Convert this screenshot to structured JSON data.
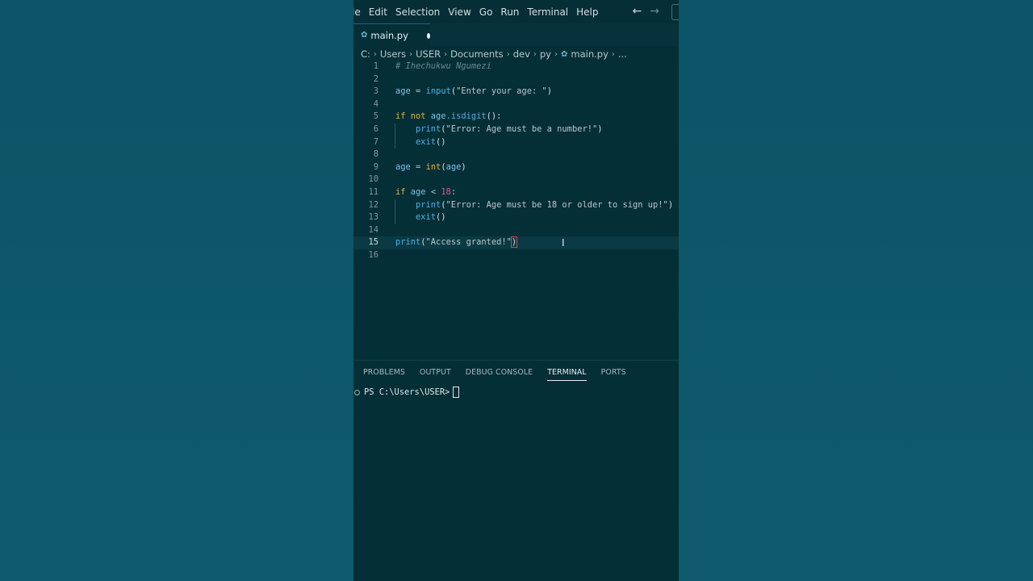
{
  "menu": [
    "le",
    "Edit",
    "Selection",
    "View",
    "Go",
    "Run",
    "Terminal",
    "Help"
  ],
  "nav": {
    "back": "←",
    "forward": "→"
  },
  "tab": {
    "label": "main.py",
    "icon": "python-icon"
  },
  "breadcrumb": [
    "C:",
    "Users",
    "USER",
    "Documents",
    "dev",
    "py",
    "main.py",
    "..."
  ],
  "code_lines": [
    {
      "n": "1"
    },
    {
      "n": "2"
    },
    {
      "n": "3"
    },
    {
      "n": "4"
    },
    {
      "n": "5"
    },
    {
      "n": "6"
    },
    {
      "n": "7"
    },
    {
      "n": "8"
    },
    {
      "n": "9"
    },
    {
      "n": "10"
    },
    {
      "n": "11"
    },
    {
      "n": "12"
    },
    {
      "n": "13"
    },
    {
      "n": "14"
    },
    {
      "n": "15"
    },
    {
      "n": "16"
    }
  ],
  "code": {
    "l1": "# Ihechukwu Ngumezi",
    "l3_var": "age",
    "l3_eq": " = ",
    "l3_fn": "input",
    "l3_str": "\"Enter your age: \"",
    "l5_kw": "if not ",
    "l5_var": "age",
    "l5_fn": ".isdigit",
    "l5_rest": "():",
    "l6_fn": "print",
    "l6_str": "\"Error: Age must be a number!\"",
    "l7_fn": "exit",
    "l7_rest": "()",
    "l9_var": "age",
    "l9_eq": " = ",
    "l9_fn": "int",
    "l9_arg": "age",
    "l11_kw": "if ",
    "l11_var": "age",
    "l11_op": " < ",
    "l11_num": "18",
    "l11_colon": ":",
    "l12_fn": "print",
    "l12_str": "\"Error: Age must be 18 or older to sign up!\"",
    "l13_fn": "exit",
    "l13_rest": "()",
    "l15_fn": "print",
    "l15_str": "\"Access granted!\""
  },
  "panel_tabs": [
    "PROBLEMS",
    "OUTPUT",
    "DEBUG CONSOLE",
    "TERMINAL",
    "PORTS"
  ],
  "active_panel_tab": "TERMINAL",
  "terminal_prompt": "PS C:\\Users\\USER>",
  "colors": {
    "editor_bg": "#052f37",
    "outer_bg": "#0b5366",
    "keyword": "#e2b43c",
    "function": "#4fb0e6",
    "number": "#e0558a"
  }
}
